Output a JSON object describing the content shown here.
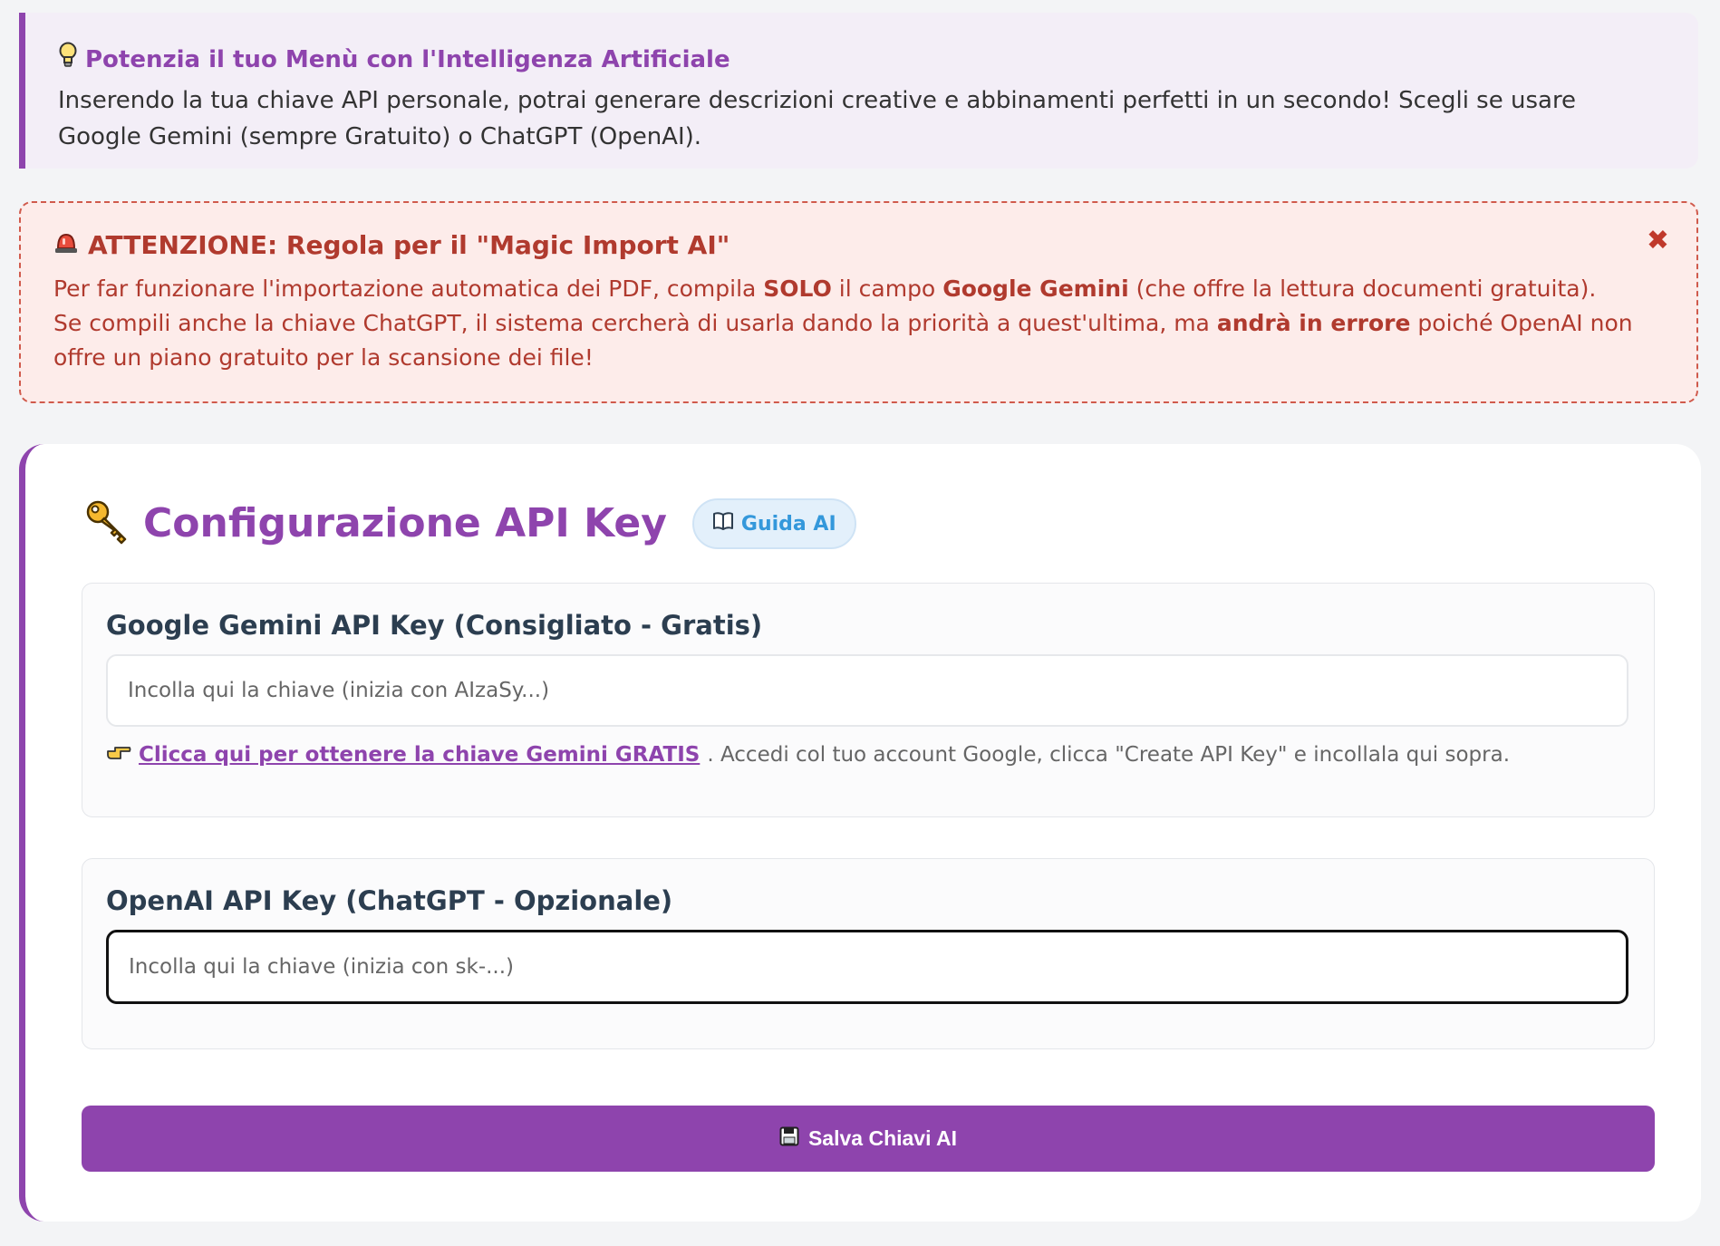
{
  "info": {
    "icon": "lightbulb-icon",
    "title": "Potenzia il tuo Menù con l'Intelligenza Artificiale",
    "text": "Inserendo la tua chiave API personale, potrai generare descrizioni creative e abbinamenti perfetti in un secondo! Scegli se usare Google Gemini (sempre Gratuito) o ChatGPT (OpenAI)."
  },
  "warning": {
    "icon": "siren-icon",
    "title": "ATTENZIONE: Regola per il \"Magic Import AI\"",
    "line1_a": "Per far funzionare l'importazione automatica dei PDF, compila ",
    "line1_b": "SOLO",
    "line1_c": " il campo ",
    "line1_d": "Google Gemini",
    "line1_e": " (che offre la lettura documenti gratuita).",
    "line2_a": "Se compili anche la chiave ChatGPT, il sistema cercherà di usarla dando la priorità a quest'ultima, ma ",
    "line2_b": "andrà in errore",
    "line2_c": " poiché OpenAI non offre un piano gratuito per la scansione dei file!",
    "close": "✖",
    "color": "#b03a2e"
  },
  "config": {
    "icon": "key-icon",
    "title": "Configurazione API Key",
    "guide_button": "Guida AI",
    "gemini": {
      "label": "Google Gemini API Key (Consigliato - Gratis)",
      "placeholder": "Incolla qui la chiave (inizia con AIzaSy...)",
      "value": "",
      "hint_link": "Clicca qui per ottenere la chiave Gemini GRATIS",
      "hint_text": ". Accedi col tuo account Google, clicca \"Create API Key\" e incollala qui sopra."
    },
    "openai": {
      "label": "OpenAI API Key (ChatGPT - Opzionale)",
      "placeholder": "Incolla qui la chiave (inizia con sk-...)",
      "value": ""
    },
    "save_button": "Salva Chiavi AI"
  },
  "colors": {
    "accent": "#8e44ad",
    "guide": "#3498db",
    "warning_bg": "#fdecea",
    "info_bg": "#f3eef7"
  }
}
